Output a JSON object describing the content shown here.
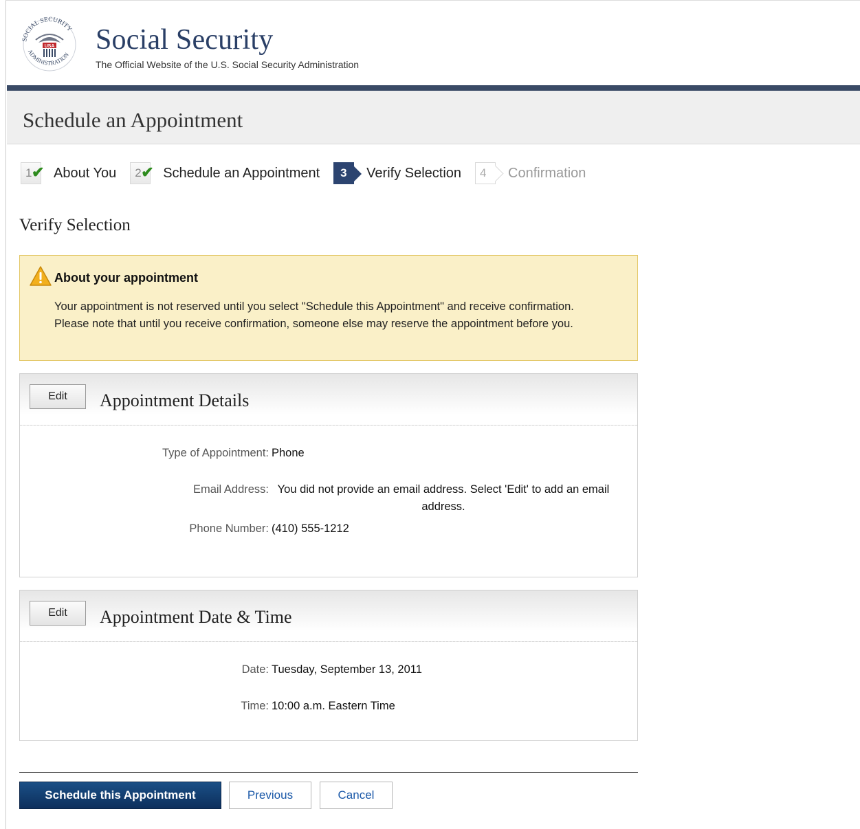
{
  "header": {
    "title": "Social Security",
    "subtitle": "The Official Website of the U.S. Social Security Administration",
    "seal": {
      "top_text": "SOCIAL SECURITY",
      "bottom_text": "ADMINISTRATION",
      "center": "USA"
    }
  },
  "page": {
    "title": "Schedule an Appointment",
    "section_heading": "Verify Selection"
  },
  "steps": [
    {
      "number": "1",
      "label": "About You",
      "state": "complete"
    },
    {
      "number": "2",
      "label": "Schedule an Appointment",
      "state": "complete"
    },
    {
      "number": "3",
      "label": "Verify Selection",
      "state": "current"
    },
    {
      "number": "4",
      "label": "Confirmation",
      "state": "future"
    }
  ],
  "alert": {
    "title": "About your appointment",
    "body": "Your appointment is not reserved until you select \"Schedule this Appointment\" and receive confirmation. Please note that until you receive confirmation, someone else may reserve the appointment before you."
  },
  "details_panel": {
    "edit_label": "Edit",
    "title": "Appointment Details",
    "rows": [
      {
        "label": "Type of Appointment:",
        "value": "Phone"
      },
      {
        "label": "Email Address:",
        "value": "You did not provide an email address. Select 'Edit' to add an email address."
      },
      {
        "label": "Phone Number:",
        "value": "(410) 555-1212"
      }
    ]
  },
  "datetime_panel": {
    "edit_label": "Edit",
    "title": "Appointment Date & Time",
    "rows": [
      {
        "label": "Date:",
        "value": "Tuesday, September 13, 2011"
      },
      {
        "label": "Time:",
        "value": "10:00 a.m. Eastern Time"
      }
    ]
  },
  "actions": {
    "primary": "Schedule this Appointment",
    "previous": "Previous",
    "cancel": "Cancel"
  },
  "colors": {
    "brand_navy": "#2a3f66",
    "header_bar": "#3a4a66",
    "alert_bg": "#faf0c8",
    "check_green": "#2e8b1e",
    "link_blue": "#1a58a8"
  }
}
